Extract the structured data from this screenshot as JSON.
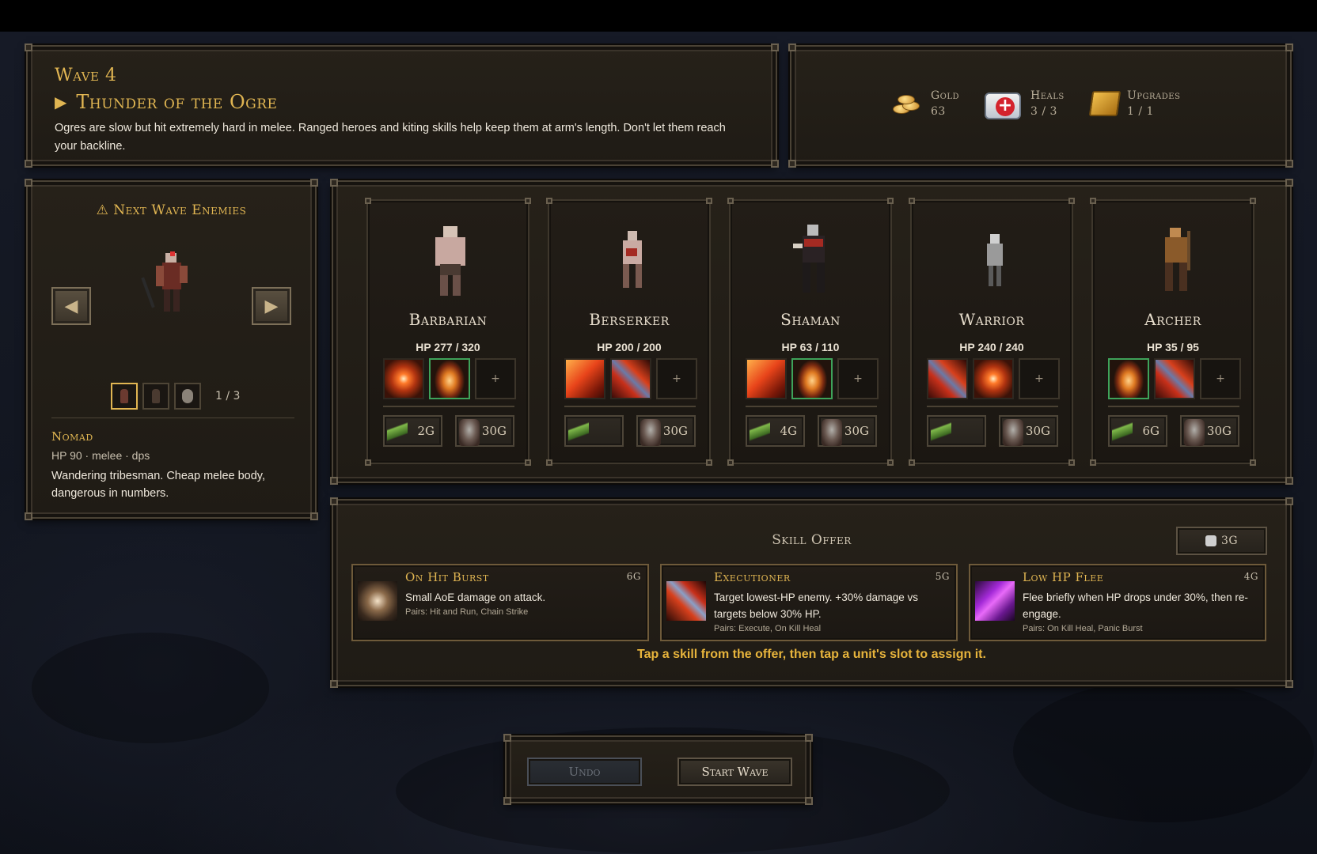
{
  "wave": {
    "label": "Wave 4",
    "title": "Thunder of the Ogre",
    "description": "Ogres are slow but hit extremely hard in melee. Ranged heroes and kiting skills help keep them at arm's length. Don't let them reach your backline."
  },
  "resources": {
    "gold": {
      "label": "Gold",
      "value": "63",
      "icon": "gold-coins-icon"
    },
    "heals": {
      "label": "Heals",
      "value": "3 / 3",
      "icon": "medkit-icon"
    },
    "upgrades": {
      "label": "Upgrades",
      "value": "1 / 1",
      "icon": "upgrade-tome-icon"
    }
  },
  "enemies": {
    "header_icon": "⚠",
    "header": "Next Wave Enemies",
    "count": "1 / 3",
    "selected": {
      "name": "Nomad",
      "stats": "HP 90 · melee · dps",
      "description": "Wandering tribesman. Cheap melee body, dangerous in numbers."
    }
  },
  "heroes": [
    {
      "name": "Barbarian",
      "hp": "HP 277 / 320",
      "skills": [
        "burst",
        "shield"
      ],
      "potion": "2G",
      "armor": "30G"
    },
    {
      "name": "Berserker",
      "hp": "HP 200 / 200",
      "skills": [
        "claw",
        "blade"
      ],
      "potion": "",
      "armor": "30G"
    },
    {
      "name": "Shaman",
      "hp": "HP 63 / 110",
      "skills": [
        "claw",
        "shield"
      ],
      "potion": "4G",
      "armor": "30G"
    },
    {
      "name": "Warrior",
      "hp": "HP 240 / 240",
      "skills": [
        "blade",
        "burst"
      ],
      "potion": "",
      "armor": "30G"
    },
    {
      "name": "Archer",
      "hp": "HP 35 / 95",
      "skills": [
        "shield",
        "blade"
      ],
      "potion": "6G",
      "armor": "30G"
    }
  ],
  "empty_slot": "+",
  "offer": {
    "title": "Skill Offer",
    "reroll_cost": "3G",
    "cards": [
      {
        "name": "On Hit Burst",
        "cost": "6G",
        "description": "Small AoE damage on attack.",
        "pairs": "Pairs: Hit and Run, Chain Strike"
      },
      {
        "name": "Executioner",
        "cost": "5G",
        "description": "Target lowest-HP enemy. +30% damage vs targets below 30% HP.",
        "pairs": "Pairs: Execute, On Kill Heal"
      },
      {
        "name": "Low HP Flee",
        "cost": "4G",
        "description": "Flee briefly when HP drops under 30%, then re-engage.",
        "pairs": "Pairs: On Kill Heal, Panic Burst"
      }
    ],
    "hint": "Tap a skill from the offer, then tap a unit's slot to assign it."
  },
  "actions": {
    "undo": "Undo",
    "start": "Start Wave"
  },
  "colors": {
    "accent_gold": "#e0b552",
    "hint": "#e7b43c",
    "panel": "#231e18"
  }
}
